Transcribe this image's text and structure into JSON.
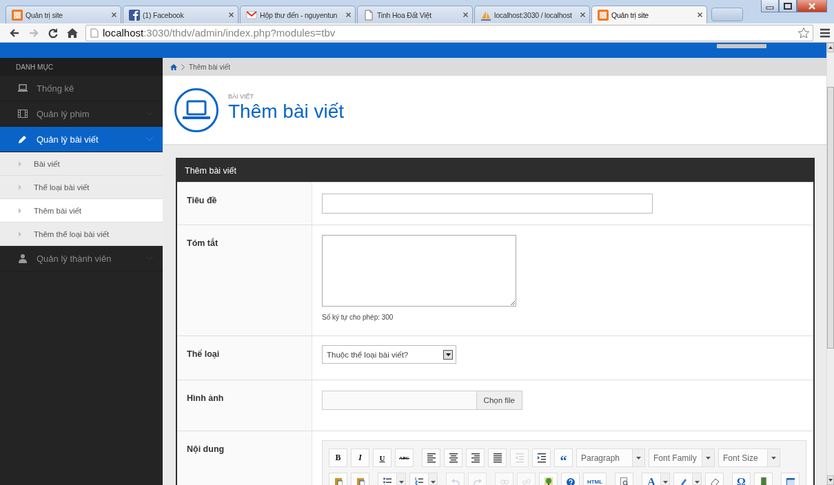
{
  "browser": {
    "tabs": [
      {
        "title": "Quản trị site",
        "kind": "app",
        "selected": false
      },
      {
        "title": "(1) Facebook",
        "kind": "social",
        "selected": false
      },
      {
        "title": "Hộp thư đến - nguyentun",
        "kind": "mail",
        "selected": false
      },
      {
        "title": "Tinh Hoa Đất Việt",
        "kind": "page",
        "selected": false
      },
      {
        "title": "localhost:3030 / localhost",
        "kind": "sail",
        "selected": false
      },
      {
        "title": "Quản trị site",
        "kind": "app",
        "selected": true
      }
    ],
    "nav": [
      {
        "kind": "back",
        "disabled": false
      },
      {
        "kind": "forward",
        "disabled": true
      },
      {
        "kind": "reload",
        "disabled": false
      },
      {
        "kind": "home",
        "disabled": false
      }
    ],
    "url_host": "localhost",
    "url_path": ":3030/thdv/admin/index.php?modules=tbv"
  },
  "sidebar": {
    "heading": "DANH MỤC",
    "items": [
      {
        "label": "Thống kê",
        "kind": "laptop",
        "selected": false,
        "expandable": false
      },
      {
        "label": "Quản lý phim",
        "kind": "film",
        "selected": false,
        "expandable": true
      },
      {
        "label": "Quản lý bài viết",
        "kind": "pencil",
        "selected": true,
        "expandable": true,
        "children": [
          {
            "label": "Bài viết",
            "selected": false
          },
          {
            "label": "Thể loại bài viết",
            "selected": false
          },
          {
            "label": "Thêm bài viết",
            "selected": true
          },
          {
            "label": "Thêm thể loại bài viết",
            "selected": false
          }
        ]
      },
      {
        "label": "Quản lý thành viên",
        "kind": "users",
        "selected": false,
        "expandable": true
      }
    ]
  },
  "breadcrumb": {
    "current": "Thêm bài viết"
  },
  "page_header": {
    "section": "BÀI VIẾT",
    "title": "Thêm bài viết"
  },
  "form": {
    "title": "Thêm bài viết",
    "rows": [
      {
        "label": "Tiêu đề",
        "kind": "text"
      },
      {
        "label": "Tóm tắt",
        "kind": "textarea",
        "hint": "Số ký tự cho phép: 300"
      },
      {
        "label": "Thể loại",
        "kind": "select",
        "value": "Thuộc thể loại bài viết?"
      },
      {
        "label": "Hình ảnh",
        "kind": "file",
        "button": "Chọn file"
      },
      {
        "label": "Nội dung",
        "kind": "editor",
        "toolbar": [
          [
            [
              {
                "kind": "bold",
                "label": "B",
                "disabled": false,
                "menu": false
              },
              {
                "kind": "italic",
                "label": "I",
                "disabled": false,
                "menu": false
              },
              {
                "kind": "underline",
                "label": "U",
                "disabled": false,
                "menu": false
              },
              {
                "kind": "strike",
                "label": "ABC",
                "disabled": false,
                "menu": false
              }
            ],
            [
              {
                "kind": "align-left",
                "disabled": false,
                "menu": false
              },
              {
                "kind": "align-center",
                "disabled": false,
                "menu": false
              },
              {
                "kind": "align-right",
                "disabled": false,
                "menu": false
              },
              {
                "kind": "align-justify",
                "disabled": false,
                "menu": false
              },
              {
                "kind": "outdent",
                "disabled": true,
                "menu": false
              },
              {
                "kind": "indent",
                "disabled": false,
                "menu": false
              },
              {
                "kind": "quote",
                "label": "“",
                "disabled": false,
                "menu": false
              },
              {
                "kind": "select",
                "label": "Paragraph"
              },
              {
                "kind": "select",
                "label": "Font Family"
              },
              {
                "kind": "select",
                "label": "Font Size"
              }
            ]
          ],
          [
            [
              {
                "kind": "paste-text",
                "disabled": false,
                "menu": false
              },
              {
                "kind": "paste-word",
                "disabled": false,
                "menu": false
              }
            ],
            [
              {
                "kind": "bullet-list",
                "disabled": false,
                "menu": true
              },
              {
                "kind": "number-list",
                "disabled": false,
                "menu": true
              }
            ],
            [
              {
                "kind": "undo",
                "disabled": true,
                "menu": false
              },
              {
                "kind": "redo",
                "disabled": true,
                "menu": false
              }
            ],
            [
              {
                "kind": "link",
                "disabled": true,
                "menu": false
              },
              {
                "kind": "unlink",
                "disabled": true,
                "menu": false
              },
              {
                "kind": "image",
                "disabled": false,
                "menu": false
              },
              {
                "kind": "help",
                "disabled": false,
                "menu": false
              },
              {
                "kind": "html",
                "label": "HTML",
                "disabled": false,
                "menu": false
              }
            ],
            [
              {
                "kind": "find",
                "disabled": false,
                "menu": false
              }
            ],
            [
              {
                "kind": "font-color",
                "label": "A",
                "disabled": false,
                "menu": true
              },
              {
                "kind": "highlight",
                "disabled": false,
                "menu": true
              },
              {
                "kind": "eraser",
                "disabled": false,
                "menu": false
              }
            ],
            [
              {
                "kind": "special-char",
                "label": "Ω",
                "disabled": false,
                "menu": false
              },
              {
                "kind": "media",
                "disabled": false,
                "menu": false
              }
            ],
            [
              {
                "kind": "fullscreen",
                "disabled": false,
                "menu": false
              }
            ]
          ]
        ]
      }
    ]
  }
}
